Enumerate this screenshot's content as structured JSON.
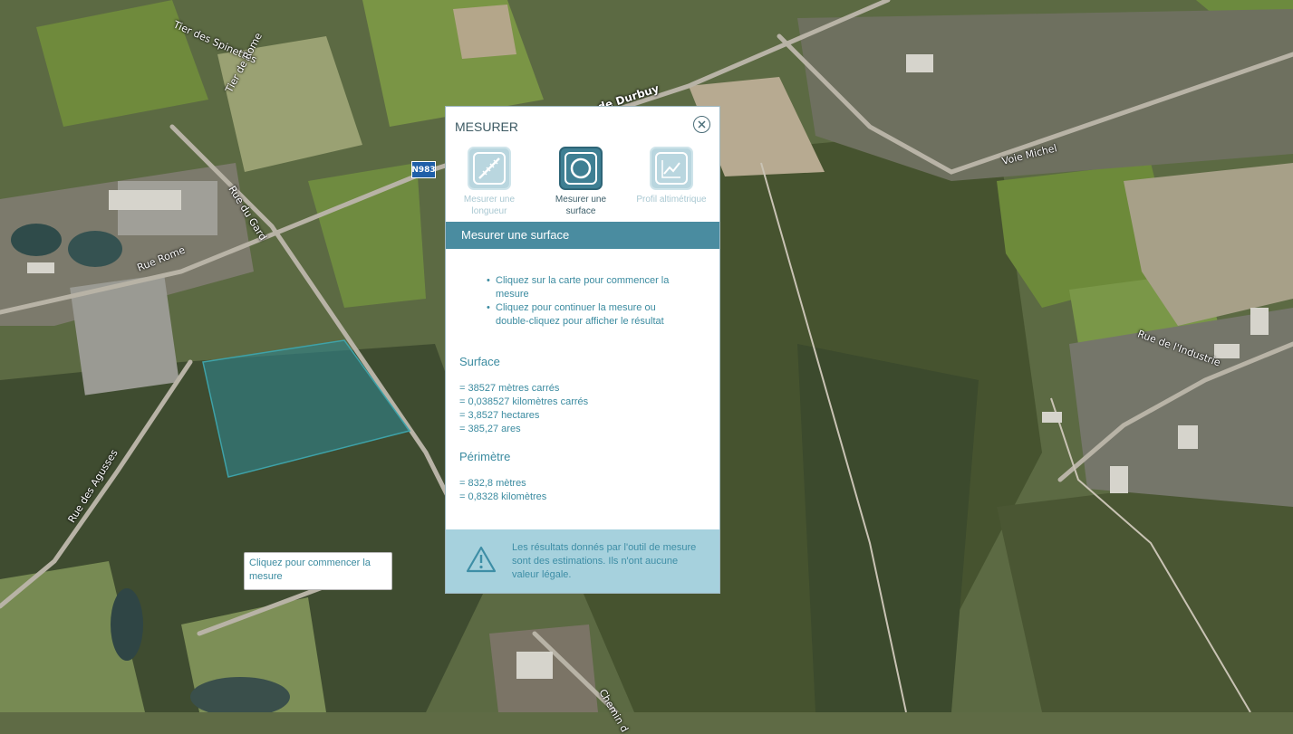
{
  "map": {
    "labels": [
      {
        "id": "tier-des-spinettes",
        "text": "Tier des Spinettes"
      },
      {
        "id": "tier-de-rome",
        "text": "Tier de Rome"
      },
      {
        "id": "route-durbuy",
        "text": "de Durbuy"
      },
      {
        "id": "rue-du-gard",
        "text": "Rue du Gard"
      },
      {
        "id": "rue-rome",
        "text": "Rue Rome"
      },
      {
        "id": "rue-des-agusses",
        "text": "Rue des Agusses"
      },
      {
        "id": "voie-michel",
        "text": "Voie Michel"
      },
      {
        "id": "rue-de-l-industrie",
        "text": "Rue de l'Industrie"
      },
      {
        "id": "chemin",
        "text": "Chemin d"
      }
    ],
    "road_shield": "N983",
    "tooltip": "Cliquez pour commencer la mesure",
    "colors": {
      "measured_area": "#2f7f86"
    }
  },
  "panel": {
    "title": "MESURER",
    "close_icon": "close-circle-icon",
    "tools": [
      {
        "label": "Mesurer une longueur",
        "icon": "ruler-icon",
        "active": false
      },
      {
        "label": "Mesurer une surface",
        "icon": "circle-area-icon",
        "active": true
      },
      {
        "label": "Profil altimétrique",
        "icon": "chart-line-icon",
        "active": false
      }
    ],
    "section_title": "Mesurer une surface",
    "instructions": [
      "Cliquez sur la carte pour commencer la mesure",
      "Cliquez pour continuer la mesure ou double-cliquez pour afficher le résultat"
    ],
    "surface": {
      "heading": "Surface",
      "values": [
        "= 38527 mètres carrés",
        "= 0,038527 kilomètres carrés",
        "= 3,8527 hectares",
        "= 385,27 ares"
      ]
    },
    "perimetre": {
      "heading": "Périmètre",
      "values": [
        "= 832,8 mètres",
        "= 0,8328 kilomètres"
      ]
    },
    "warning": "Les résultats donnés par l'outil de mesure sont des estimations. Ils n'ont aucune valeur légale."
  }
}
